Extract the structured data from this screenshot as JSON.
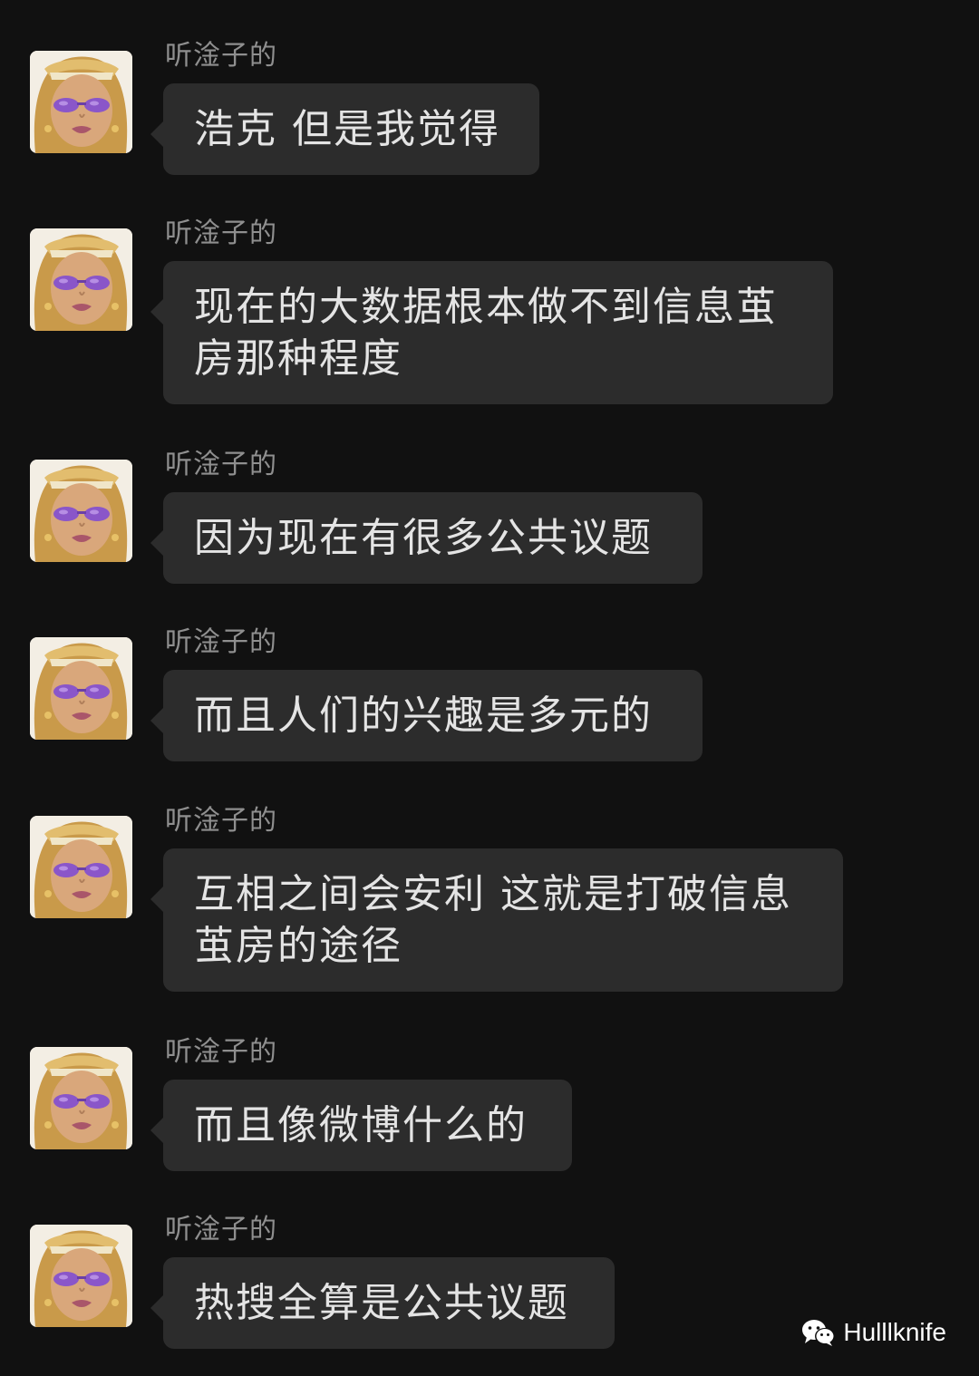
{
  "chat": {
    "messages": [
      {
        "sender": "听淦子的",
        "text": "浩克 但是我觉得"
      },
      {
        "sender": "听淦子的",
        "text": "现在的大数据根本做不到信息茧房那种程度"
      },
      {
        "sender": "听淦子的",
        "text": "因为现在有很多公共议题"
      },
      {
        "sender": "听淦子的",
        "text": "而且人们的兴趣是多元的"
      },
      {
        "sender": "听淦子的",
        "text": "互相之间会安利 这就是打破信息茧房的途径"
      },
      {
        "sender": "听淦子的",
        "text": "而且像微博什么的"
      },
      {
        "sender": "听淦子的",
        "text": "热搜全算是公共议题"
      }
    ]
  },
  "watermark": {
    "icon": "wechat-icon",
    "label": "Hulllknife"
  }
}
